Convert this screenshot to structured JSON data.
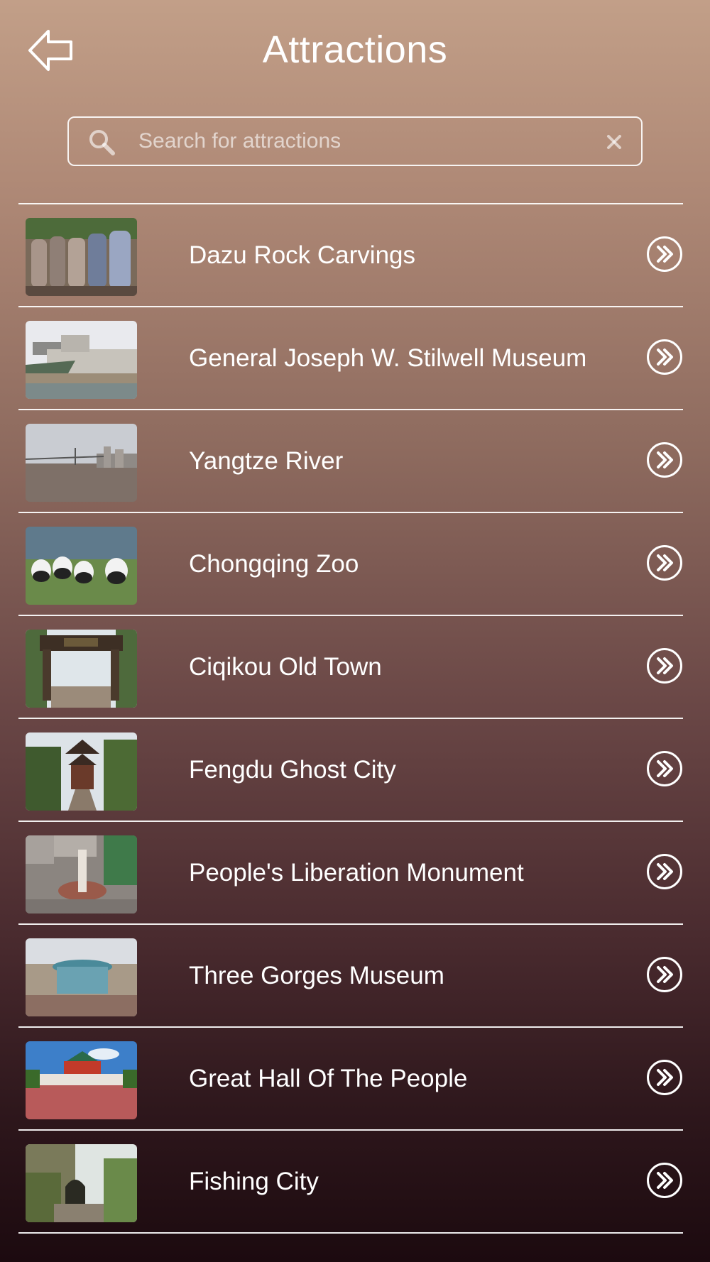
{
  "header": {
    "title": "Attractions",
    "back_icon": "back-arrow-icon"
  },
  "search": {
    "placeholder": "Search for attractions",
    "value": "",
    "search_icon": "search-icon",
    "clear_icon": "clear-icon"
  },
  "attractions": [
    {
      "label": "Dazu Rock Carvings",
      "thumb": "dazu-rock-carvings-photo",
      "arrow_icon": "double-chevron-right-icon"
    },
    {
      "label": "General Joseph W. Stilwell Museum",
      "thumb": "stilwell-museum-photo",
      "arrow_icon": "double-chevron-right-icon"
    },
    {
      "label": "Yangtze River",
      "thumb": "yangtze-river-photo",
      "arrow_icon": "double-chevron-right-icon"
    },
    {
      "label": "Chongqing Zoo",
      "thumb": "chongqing-zoo-photo",
      "arrow_icon": "double-chevron-right-icon"
    },
    {
      "label": "Ciqikou Old Town",
      "thumb": "ciqikou-old-town-photo",
      "arrow_icon": "double-chevron-right-icon"
    },
    {
      "label": "Fengdu Ghost City",
      "thumb": "fengdu-ghost-city-photo",
      "arrow_icon": "double-chevron-right-icon"
    },
    {
      "label": "People's Liberation Monument",
      "thumb": "liberation-monument-photo",
      "arrow_icon": "double-chevron-right-icon"
    },
    {
      "label": "Three Gorges Museum",
      "thumb": "three-gorges-museum-photo",
      "arrow_icon": "double-chevron-right-icon"
    },
    {
      "label": "Great Hall Of The People",
      "thumb": "great-hall-photo",
      "arrow_icon": "double-chevron-right-icon"
    },
    {
      "label": "Fishing City",
      "thumb": "fishing-city-photo",
      "arrow_icon": "double-chevron-right-icon"
    }
  ],
  "colors": {
    "background_top": "#c29f88",
    "background_bottom": "#1c0a0f",
    "text": "#ffffff",
    "divider": "#ffffff"
  }
}
